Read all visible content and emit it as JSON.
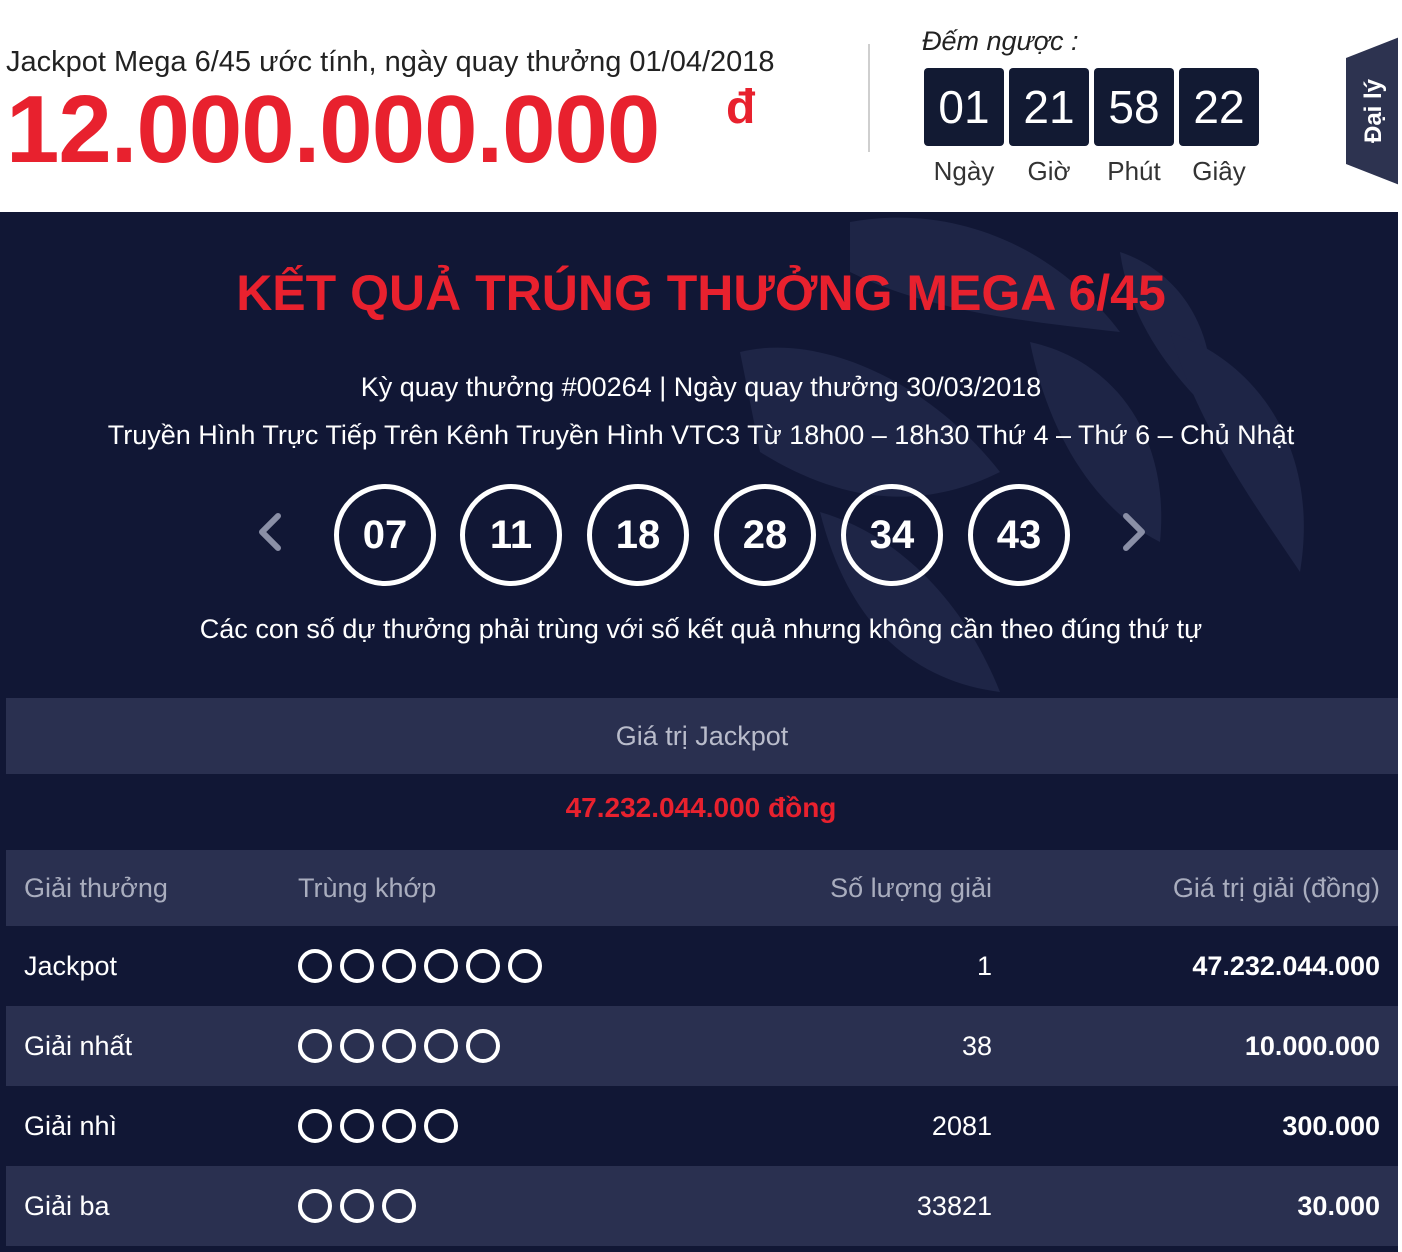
{
  "header": {
    "jackpot_caption": "Jackpot Mega 6/45 ước tính, ngày quay thưởng 01/04/2018",
    "jackpot_amount": "12.000.000.000",
    "jackpot_unit": "đ",
    "countdown_label": "Đếm ngược :",
    "countdown": [
      {
        "value": "01",
        "unit": "Ngày"
      },
      {
        "value": "21",
        "unit": "Giờ"
      },
      {
        "value": "58",
        "unit": "Phút"
      },
      {
        "value": "22",
        "unit": "Giây"
      }
    ],
    "side_tab": "Đại lý"
  },
  "results": {
    "title": "KẾT QUẢ TRÚNG THƯỞNG MEGA 6/45",
    "draw_info": "Kỳ quay thưởng #00264 | Ngày quay thưởng 30/03/2018",
    "broadcast": "Truyền Hình Trực Tiếp Trên Kênh Truyền Hình VTC3 Từ 18h00 – 18h30 Thứ 4 – Thứ 6 – Chủ Nhật",
    "numbers": [
      "07",
      "11",
      "18",
      "28",
      "34",
      "43"
    ],
    "note": "Các con số dự thưởng phải trùng với số kết quả nhưng không cần theo đúng thứ tự",
    "jackpot_label": "Giá trị Jackpot",
    "jackpot_value": "47.232.044.000 đồng"
  },
  "prize_table": {
    "headers": [
      "Giải thưởng",
      "Trùng khớp",
      "Số lượng giải",
      "Giá trị giải (đồng)"
    ],
    "rows": [
      {
        "prize": "Jackpot",
        "matches": 6,
        "count": "1",
        "value": "47.232.044.000"
      },
      {
        "prize": "Giải nhất",
        "matches": 5,
        "count": "38",
        "value": "10.000.000"
      },
      {
        "prize": "Giải nhì",
        "matches": 4,
        "count": "2081",
        "value": "300.000"
      },
      {
        "prize": "Giải ba",
        "matches": 3,
        "count": "33821",
        "value": "30.000"
      }
    ]
  },
  "colors": {
    "accent_red": "#e8212e",
    "panel_bg": "#111735",
    "row_alt_bg": "#2a3050",
    "countdown_bg": "#121a33"
  }
}
